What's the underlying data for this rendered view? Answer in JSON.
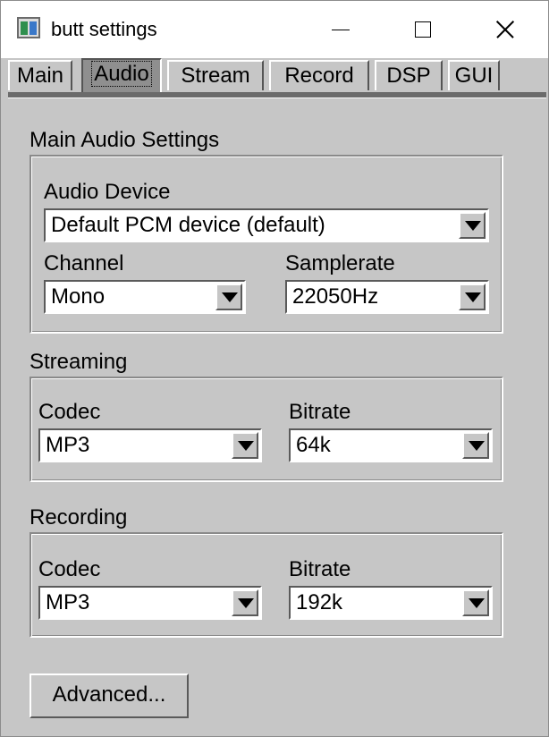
{
  "window": {
    "title": "butt settings"
  },
  "tabs": [
    {
      "label": "Main"
    },
    {
      "label": "Audio"
    },
    {
      "label": "Stream"
    },
    {
      "label": "Record"
    },
    {
      "label": "DSP"
    },
    {
      "label": "GUI"
    }
  ],
  "active_tab": "Audio",
  "main_audio": {
    "title": "Main Audio Settings",
    "device_label": "Audio Device",
    "device_value": "Default PCM device (default)",
    "channel_label": "Channel",
    "channel_value": "Mono",
    "samplerate_label": "Samplerate",
    "samplerate_value": "22050Hz"
  },
  "streaming": {
    "title": "Streaming",
    "codec_label": "Codec",
    "codec_value": "MP3",
    "bitrate_label": "Bitrate",
    "bitrate_value": "64k"
  },
  "recording": {
    "title": "Recording",
    "codec_label": "Codec",
    "codec_value": "MP3",
    "bitrate_label": "Bitrate",
    "bitrate_value": "192k"
  },
  "advanced_button": "Advanced..."
}
